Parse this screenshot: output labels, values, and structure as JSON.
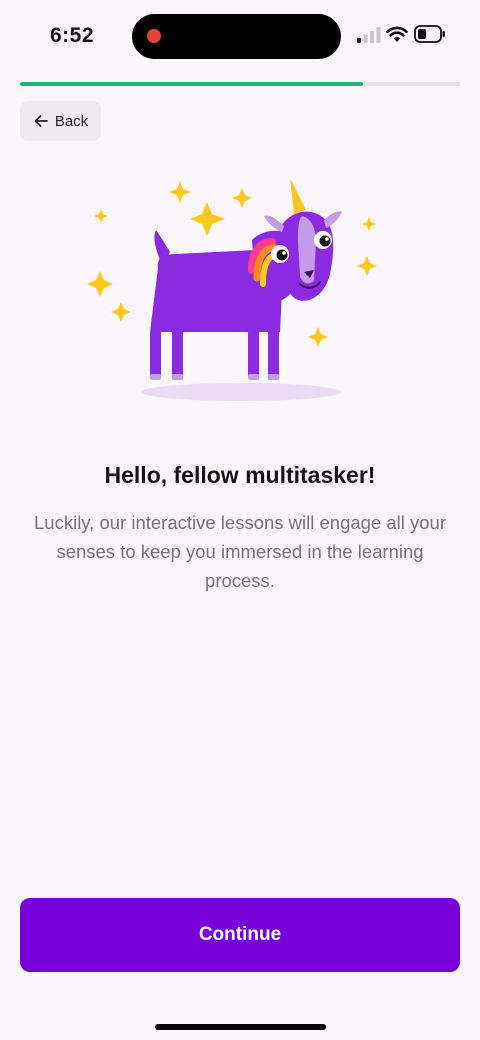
{
  "status_bar": {
    "time": "6:52",
    "icons": [
      "recording-indicator",
      "cellular-signal-icon",
      "wifi-icon",
      "battery-icon"
    ],
    "recording_color": "#e0433a"
  },
  "progress": {
    "value": 0.78,
    "color": "#1bb57a"
  },
  "back_button": {
    "label": "Back",
    "icon": "arrow-left-icon"
  },
  "illustration": {
    "subject": "purple-unicorn-goat",
    "colors": {
      "body": "#8a2be2",
      "sparkle": "#ffc81e",
      "horn": "#ffc31f"
    }
  },
  "content": {
    "headline": "Hello, fellow multitasker!",
    "body": "Luckily, our interactive lessons will engage all your senses to keep you immersed in the learning process."
  },
  "continue_button": {
    "label": "Continue",
    "color": "#7700d9"
  }
}
